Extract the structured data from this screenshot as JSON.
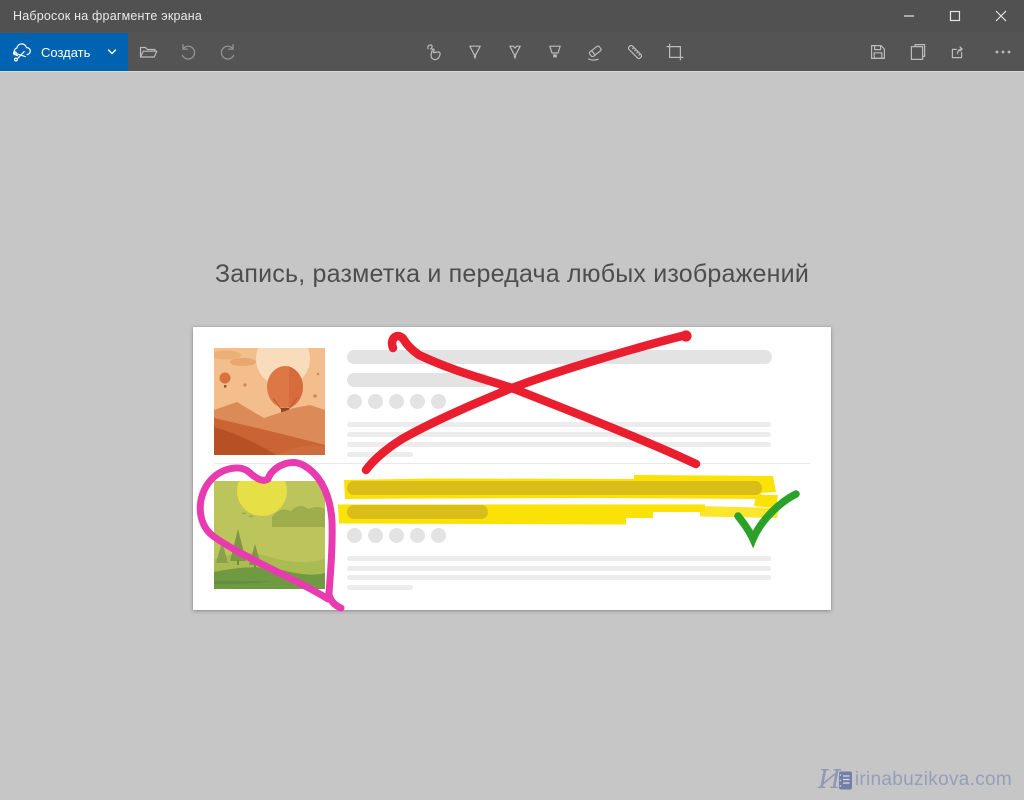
{
  "window": {
    "title": "Набросок на фрагменте экрана",
    "controls": [
      "minimize",
      "maximize",
      "close"
    ]
  },
  "toolbar": {
    "new_button": {
      "label": "Создать",
      "icon": "snip-scissors",
      "chevron": "chevron-down"
    },
    "left_tools": [
      "open-folder",
      "undo",
      "redo"
    ],
    "ink_tools": [
      "touch-writing",
      "ballpoint-pen",
      "pencil",
      "highlighter",
      "eraser",
      "ruler",
      "crop"
    ],
    "right_tools": [
      "save",
      "copy",
      "share",
      "more"
    ]
  },
  "canvas": {
    "heading": "Запись, разметка и передача любых изображений"
  },
  "watermark": {
    "text": "irinabuzikova.com",
    "script_glyph": "И"
  },
  "colors": {
    "accent_blue": "#0063b1",
    "header_gray": "#545454",
    "canvas_gray": "#c6c6c6",
    "annotation_red": "#e91f2f",
    "annotation_yellow": "#fbe206",
    "annotation_yellow_dark": "#d9bd18",
    "annotation_pink": "#e83bb0",
    "annotation_green": "#2aa22a"
  }
}
